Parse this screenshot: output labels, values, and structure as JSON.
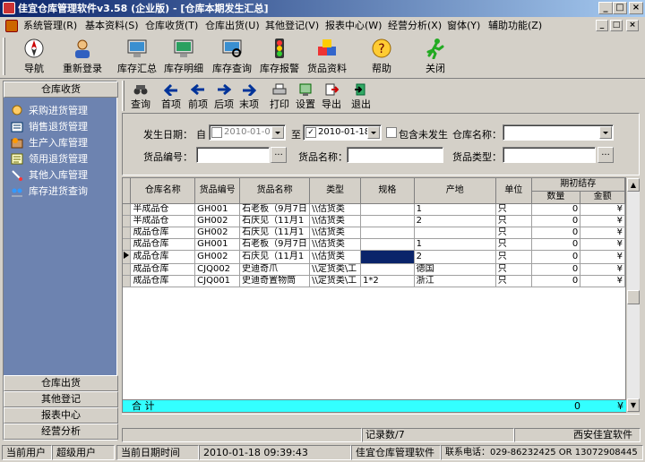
{
  "window": {
    "title": "佳宜仓库管理软件v3.58 (企业版) - [仓库本期发生汇总]",
    "controls": [
      "_",
      "□",
      "×"
    ]
  },
  "menu": [
    "系统管理(R)",
    "基本资料(S)",
    "仓库收货(T)",
    "仓库出货(U)",
    "其他登记(V)",
    "报表中心(W)",
    "经营分析(X)",
    "窗体(Y)",
    "辅助功能(Z)"
  ],
  "mdi_controls": [
    "_",
    "□",
    "×"
  ],
  "toolbar": [
    {
      "label": "导航",
      "icon": "navigation-icon"
    },
    {
      "label": "重新登录",
      "icon": "relogin-icon"
    },
    {
      "label": "库存汇总",
      "icon": "inventory-summary-icon"
    },
    {
      "label": "库存明细",
      "icon": "inventory-detail-icon"
    },
    {
      "label": "库存查询",
      "icon": "inventory-query-icon"
    },
    {
      "label": "库存报警",
      "icon": "traffic-light-icon"
    },
    {
      "label": "货品资料",
      "icon": "goods-cubes-icon"
    },
    {
      "label": "帮助",
      "icon": "help-icon"
    },
    {
      "label": "关闭",
      "icon": "running-man-icon"
    }
  ],
  "sidebar": {
    "header": "仓库收货",
    "items": [
      {
        "label": "采购进货管理",
        "icon": "purchase-icon"
      },
      {
        "label": "销售退货管理",
        "icon": "sales-return-icon"
      },
      {
        "label": "生产入库管理",
        "icon": "production-icon"
      },
      {
        "label": "领用退货管理",
        "icon": "requisition-return-icon"
      },
      {
        "label": "其他入库管理",
        "icon": "other-inbound-icon"
      },
      {
        "label": "库存进货查询",
        "icon": "stock-query-icon"
      }
    ],
    "footer": [
      "仓库出货",
      "其他登记",
      "报表中心",
      "经营分析"
    ]
  },
  "subtoolbar": [
    {
      "label": "查询",
      "icon": "binoculars-icon"
    },
    {
      "label": "首项",
      "icon": "first-arrow-icon"
    },
    {
      "label": "前项",
      "icon": "prev-arrow-icon"
    },
    {
      "label": "后项",
      "icon": "next-arrow-icon"
    },
    {
      "label": "末项",
      "icon": "last-arrow-icon"
    },
    {
      "label": "打印",
      "icon": "printer-icon"
    },
    {
      "label": "设置",
      "icon": "settings-icon"
    },
    {
      "label": "导出",
      "icon": "export-icon"
    },
    {
      "label": "退出",
      "icon": "exit-icon"
    }
  ],
  "filters": {
    "date_label": "发生日期：",
    "from_label": "自",
    "from_value": "2010-01-01",
    "to_label": "至",
    "to_value": "2010-01-18",
    "include_label": "包含未发生",
    "warehouse_label": "仓库名称：",
    "warehouse_value": "",
    "code_label": "货品编号：",
    "code_value": "",
    "name_label": "货品名称：",
    "name_value": "",
    "type_label": "货品类型：",
    "type_value": "",
    "ellipsis": "..."
  },
  "grid": {
    "group_header": "期初结存",
    "columns": [
      "仓库名称",
      "货品编号",
      "货品名称",
      "类型",
      "规格",
      "产地",
      "单位",
      "数量",
      "金额"
    ],
    "rows": [
      [
        "半成品仓",
        "GH001",
        "石老板（9月7日",
        "\\\\估货类",
        "",
        "1",
        "只",
        "0",
        "¥"
      ],
      [
        "半成品仓",
        "GH002",
        "石庆见（11月1",
        "\\\\估货类",
        "",
        "2",
        "只",
        "0",
        "¥"
      ],
      [
        "成品仓库",
        "GH002",
        "石庆见（11月1",
        "\\\\估货类",
        "",
        "",
        "只",
        "0",
        "¥"
      ],
      [
        "成品仓库",
        "GH001",
        "石老板（9月7日",
        "\\\\估货类",
        "",
        "1",
        "只",
        "0",
        "¥"
      ],
      [
        "成品仓库",
        "GH002",
        "石庆见（11月1",
        "\\\\估货类",
        "",
        "2",
        "只",
        "0",
        "¥"
      ],
      [
        "成品仓库",
        "CJQ002",
        "史迪奇爪",
        "\\\\定货类\\工",
        "",
        "德国",
        "只",
        "0",
        "¥"
      ],
      [
        "成品仓库",
        "CJQ001",
        "史迪奇置物筒",
        "\\\\定货类\\工",
        "1*2",
        "浙江",
        "只",
        "0",
        "¥"
      ]
    ],
    "selected_row": 4,
    "total_label": "合  计",
    "total_qty": "0",
    "total_amount": "¥",
    "record_count": "记录数/7",
    "company": "西安佳宜软件"
  },
  "status": {
    "user_label": "当前用户",
    "user_value": "超级用户",
    "date_label": "当前日期时间",
    "date_value": "2010-01-18 09:39:43",
    "product": "佳宜仓库管理软件",
    "phone": "联系电话：029-86232425 OR 13072908445"
  },
  "colors": {
    "title_start": "#0a246a",
    "title_end": "#a6caf0",
    "sidebar_bg": "#6d83b0",
    "total_row": "#33ffff",
    "selected_cell": "#0a246a"
  }
}
